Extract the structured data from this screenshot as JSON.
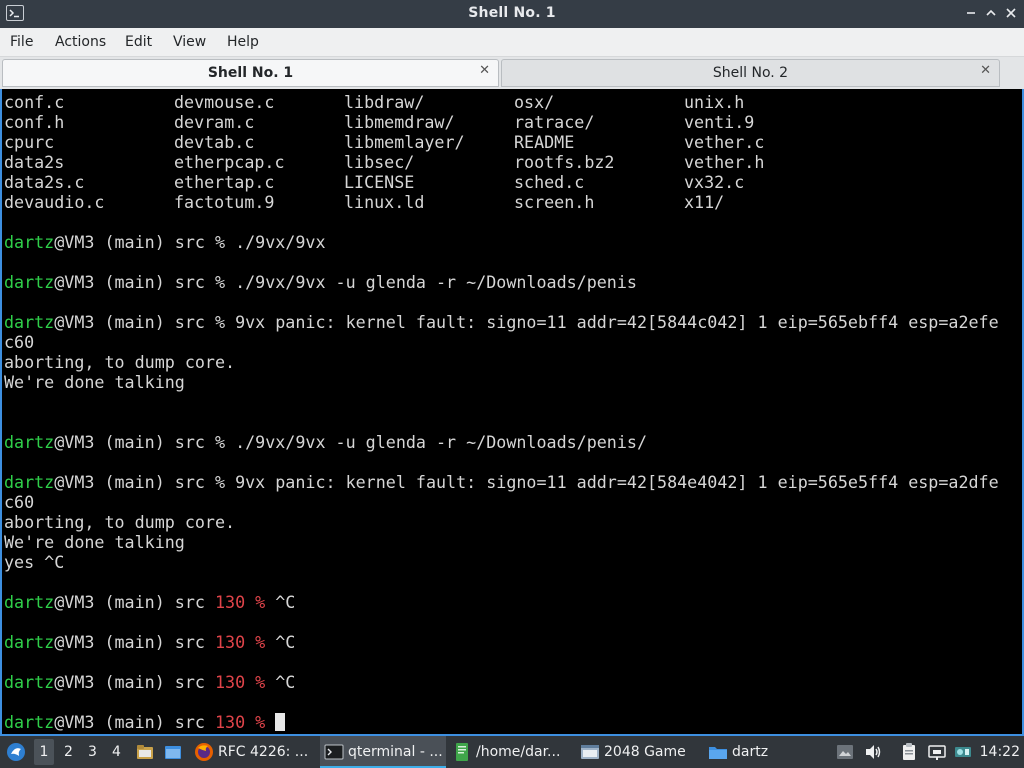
{
  "window": {
    "title": "Shell No. 1"
  },
  "menubar": {
    "items": [
      "File",
      "Actions",
      "Edit",
      "View",
      "Help"
    ]
  },
  "tabs": [
    {
      "label": "Shell No. 1",
      "active": true
    },
    {
      "label": "Shell No. 2",
      "active": false
    }
  ],
  "terminal": {
    "listing": [
      [
        "conf.c",
        "devmouse.c",
        "libdraw/",
        "osx/",
        "unix.h"
      ],
      [
        "conf.h",
        "devram.c",
        "libmemdraw/",
        "ratrace/",
        "venti.9"
      ],
      [
        "cpurc",
        "devtab.c",
        "libmemlayer/",
        "README",
        "vether.c"
      ],
      [
        "data2s",
        "etherpcap.c",
        "libsec/",
        "rootfs.bz2",
        "vether.h"
      ],
      [
        "data2s.c",
        "ethertap.c",
        "LICENSE",
        "sched.c",
        "vx32.c"
      ],
      [
        "devaudio.c",
        "factotum.9",
        "linux.ld",
        "screen.h",
        "x11/"
      ]
    ],
    "prompt_user": "dartz",
    "prompt_host": "@VM3 (main) src",
    "lines": {
      "l8": {
        "status": "",
        "sep": " % ",
        "cmd": "./9vx/9vx"
      },
      "l10": {
        "status": "",
        "sep": " % ",
        "cmd": "./9vx/9vx -u glenda -r ~/Downloads/penis"
      },
      "l12": {
        "status": "",
        "sep": " % ",
        "cmd": "9vx panic: kernel fault: signo=11 addr=42[5844c042] 1 eip=565ebff4 esp=a2efe"
      },
      "l13": "c60",
      "l14": "aborting, to dump core.",
      "l15": "We're done talking",
      "l18": {
        "status": "",
        "sep": " % ",
        "cmd": "./9vx/9vx -u glenda -r ~/Downloads/penis/"
      },
      "l20": {
        "status": "",
        "sep": " % ",
        "cmd": "9vx panic: kernel fault: signo=11 addr=42[584e4042] 1 eip=565e5ff4 esp=a2dfe"
      },
      "l21": "c60",
      "l22": "aborting, to dump core.",
      "l23": "We're done talking",
      "l24": "yes ^C",
      "l26": {
        "status": "130",
        "sep": " % ",
        "cmd": "^C"
      },
      "l28": {
        "status": "130",
        "sep": " % ",
        "cmd": "^C"
      },
      "l30": {
        "status": "130",
        "sep": " % ",
        "cmd": "^C"
      },
      "l32": {
        "status": "130",
        "sep": " % ",
        "cmd": ""
      }
    }
  },
  "taskbar": {
    "desktops": [
      "1",
      "2",
      "3",
      "4"
    ],
    "tasks": [
      {
        "label": "RFC 4226: ...",
        "icon": "firefox-icon"
      },
      {
        "label": "qterminal - ...",
        "icon": "terminal-icon"
      },
      {
        "label": "/home/dar...",
        "icon": "text-editor-icon"
      },
      {
        "label": "2048 Game",
        "icon": "window-icon"
      },
      {
        "label": "dartz",
        "icon": "folder-icon"
      }
    ],
    "clock": "14:22"
  },
  "colors": {
    "prompt_user": "#2fcf4a",
    "error_status": "#e0444a",
    "terminal_bg": "#000000",
    "terminal_fg": "#d6d6d6",
    "focus_border": "#3d8fe0"
  }
}
